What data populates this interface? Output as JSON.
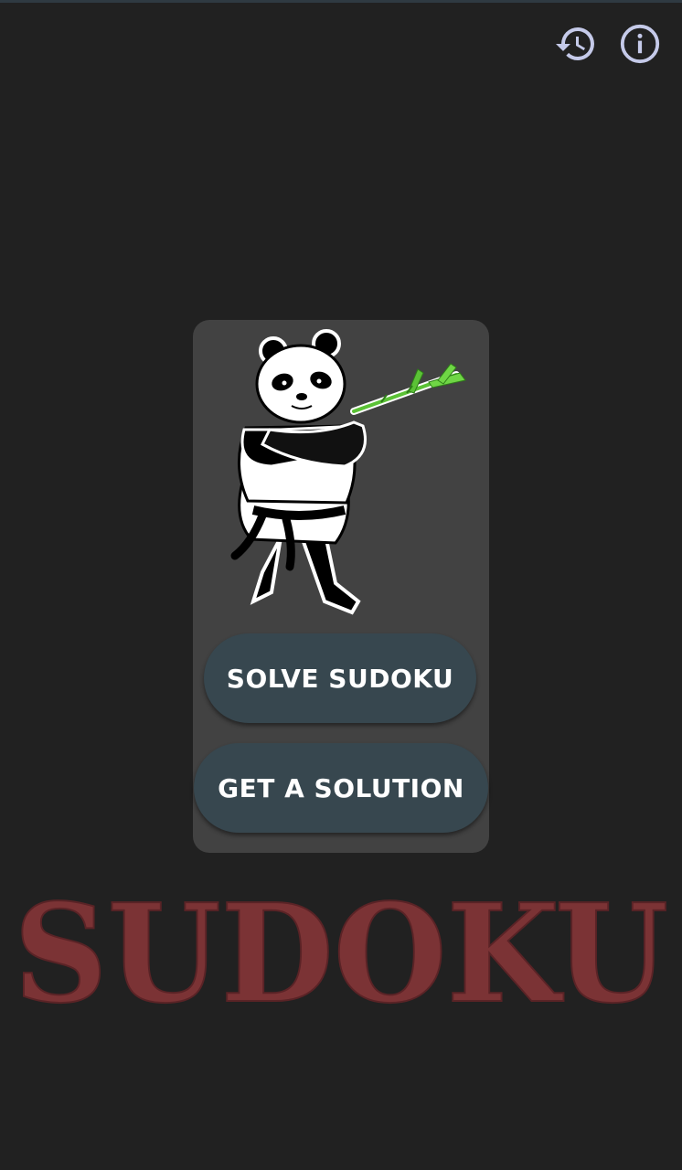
{
  "toolbar": {
    "history_icon": "history-icon",
    "info_icon": "info-icon",
    "icon_color": "#c5cae9"
  },
  "card": {
    "mascot": "panda-karate-mascot",
    "background_color": "#424242"
  },
  "buttons": {
    "solve_label": "SOLVE SUDOKU",
    "solution_label": "GET A SOLUTION",
    "color": "#37474f"
  },
  "logo": {
    "text": "SUDOKU",
    "color": "#7b3335"
  }
}
